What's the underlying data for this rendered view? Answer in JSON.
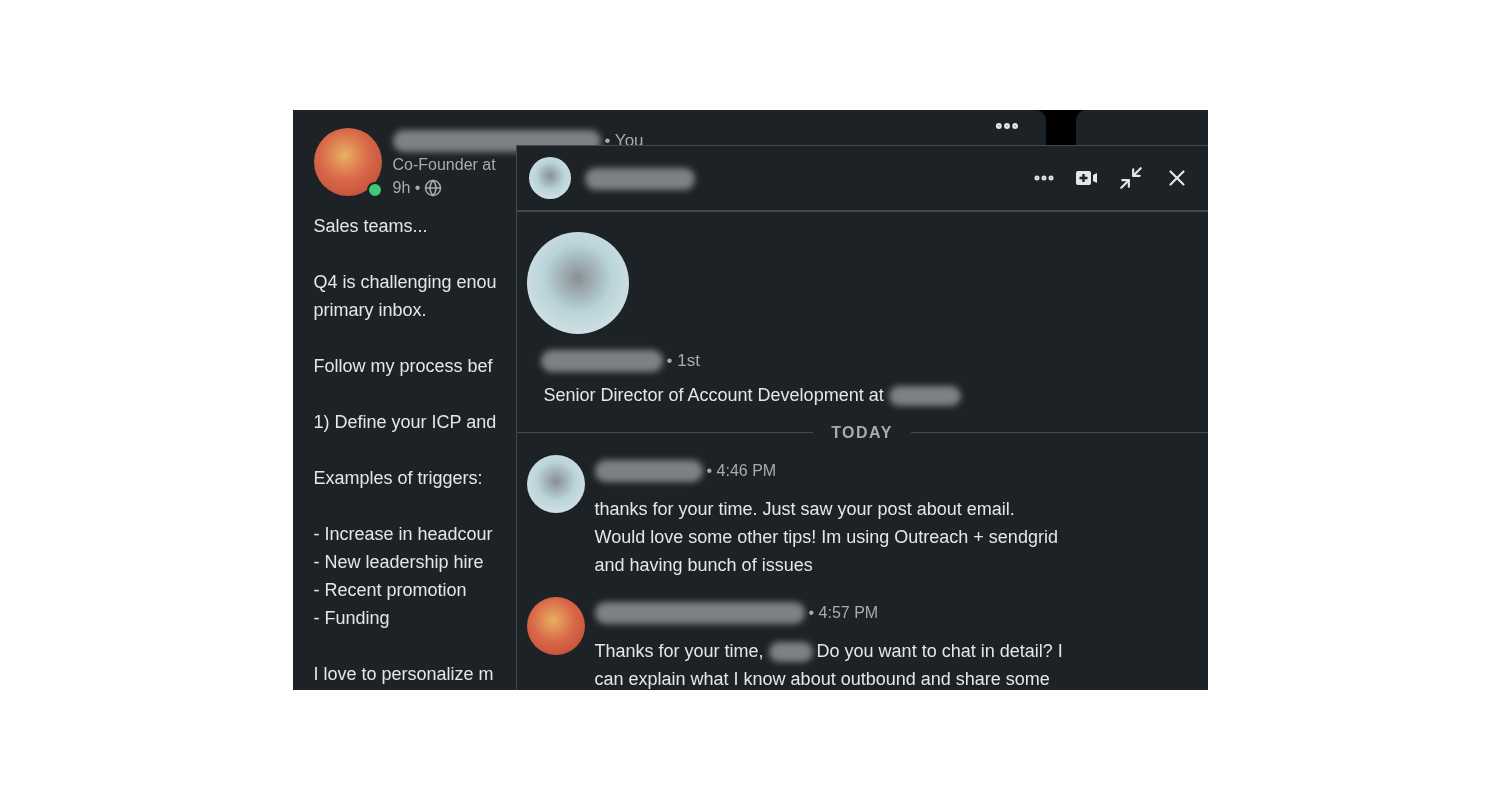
{
  "post": {
    "author": {
      "kind": "redacted"
    },
    "relation": "• You",
    "headline": "Co-Founder at",
    "time": "9h •",
    "online": true,
    "paragraphs": [
      [
        "Sales teams..."
      ],
      [
        "Q4 is challenging enou",
        "primary inbox."
      ],
      [
        "Follow my process bef"
      ],
      [
        "1) Define your ICP and"
      ],
      [
        "Examples of triggers:"
      ],
      [
        "- Increase in headcour",
        "- New leadership hire",
        "- Recent promotion",
        "- Funding"
      ],
      [
        "I love to personalize m"
      ]
    ]
  },
  "chat": {
    "contact": {
      "kind": "redacted"
    },
    "profile": {
      "name": {
        "kind": "redacted"
      },
      "degree": "• 1st",
      "headline": [
        {
          "kind": "text",
          "text": "Senior Director of Account Development at"
        },
        {
          "kind": "redacted"
        }
      ]
    },
    "divider": "TODAY",
    "messages": [
      {
        "kind": "contact",
        "time": "• 4:46 PM",
        "lines": [
          [
            {
              "kind": "text",
              "text": "thanks for your time. Just saw your post about email."
            }
          ],
          [
            {
              "kind": "text",
              "text": "Would love some other tips! Im using Outreach + sendgrid"
            }
          ],
          [
            {
              "kind": "text",
              "text": "and having bunch of issues"
            }
          ]
        ]
      },
      {
        "kind": "self",
        "time": "• 4:57 PM",
        "lines": [
          [
            {
              "kind": "text",
              "text": "Thanks for your time,"
            },
            {
              "kind": "redacted"
            },
            {
              "kind": "text",
              "text": "Do you want to chat in detail? I"
            }
          ],
          [
            {
              "kind": "text",
              "text": "can explain what I know about outbound and share some"
            }
          ]
        ]
      }
    ]
  }
}
